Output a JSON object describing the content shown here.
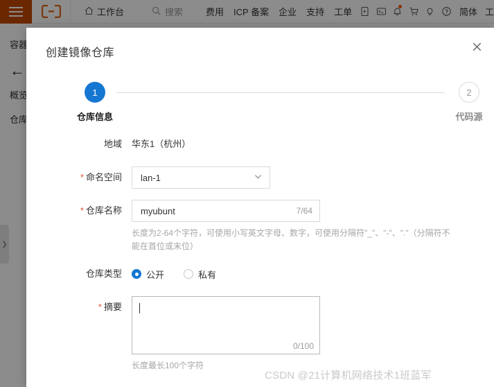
{
  "topbar": {
    "menu_icon": "hamburger-icon",
    "logo_icon": "aliyun-logo-icon",
    "workbench_label": "工作台",
    "workbench_icon": "home-icon",
    "search_placeholder": "搜索",
    "search_icon": "search-icon",
    "links": [
      "费用",
      "ICP 备案",
      "企业",
      "支持",
      "工单"
    ],
    "icons": [
      "mobile-app-icon",
      "cloud-shell-icon",
      "notification-bell-icon",
      "shopping-cart-icon",
      "idea-bulb-icon",
      "help-question-icon"
    ],
    "language_label": "简体",
    "partial_right": "工"
  },
  "sidebar": {
    "product_title": "容器镜像服务",
    "back_icon": "back-arrow-icon",
    "items": [
      "概览",
      "仓库管理"
    ],
    "collapse_icon": "chevron-right-icon"
  },
  "modal": {
    "title": "创建镜像仓库",
    "close_icon": "close-icon",
    "steps": [
      {
        "number": "1",
        "label": "仓库信息",
        "state": "active"
      },
      {
        "number": "2",
        "label": "代码源",
        "state": "inactive"
      }
    ],
    "form": {
      "region": {
        "label": "地域",
        "required": false,
        "value": "华东1（杭州）"
      },
      "namespace": {
        "label": "命名空间",
        "required": true,
        "value": "lan-1",
        "caret_icon": "chevron-down-icon"
      },
      "repo_name": {
        "label": "仓库名称",
        "required": true,
        "value": "myubunt",
        "counter": "7/64",
        "hint": "长度为2-64个字符，可使用小写英文字母、数字，可使用分隔符\"_\"、\"-\"、\".\"（分隔符不能在首位或末位）"
      },
      "repo_type": {
        "label": "仓库类型",
        "required": false,
        "options": [
          {
            "label": "公开",
            "selected": true
          },
          {
            "label": "私有",
            "selected": false
          }
        ]
      },
      "summary": {
        "label": "摘要",
        "required": true,
        "value": "",
        "counter": "0/100",
        "hint": "长度最长100个字符"
      }
    }
  },
  "watermark": {
    "text": "CSDN @21计算机网络技术1班蓝军"
  },
  "colors": {
    "accent_blue": "#1677d2",
    "brand_orange": "#c44a00",
    "required_red": "#e8503a",
    "notification_dot": "#ff5000"
  }
}
